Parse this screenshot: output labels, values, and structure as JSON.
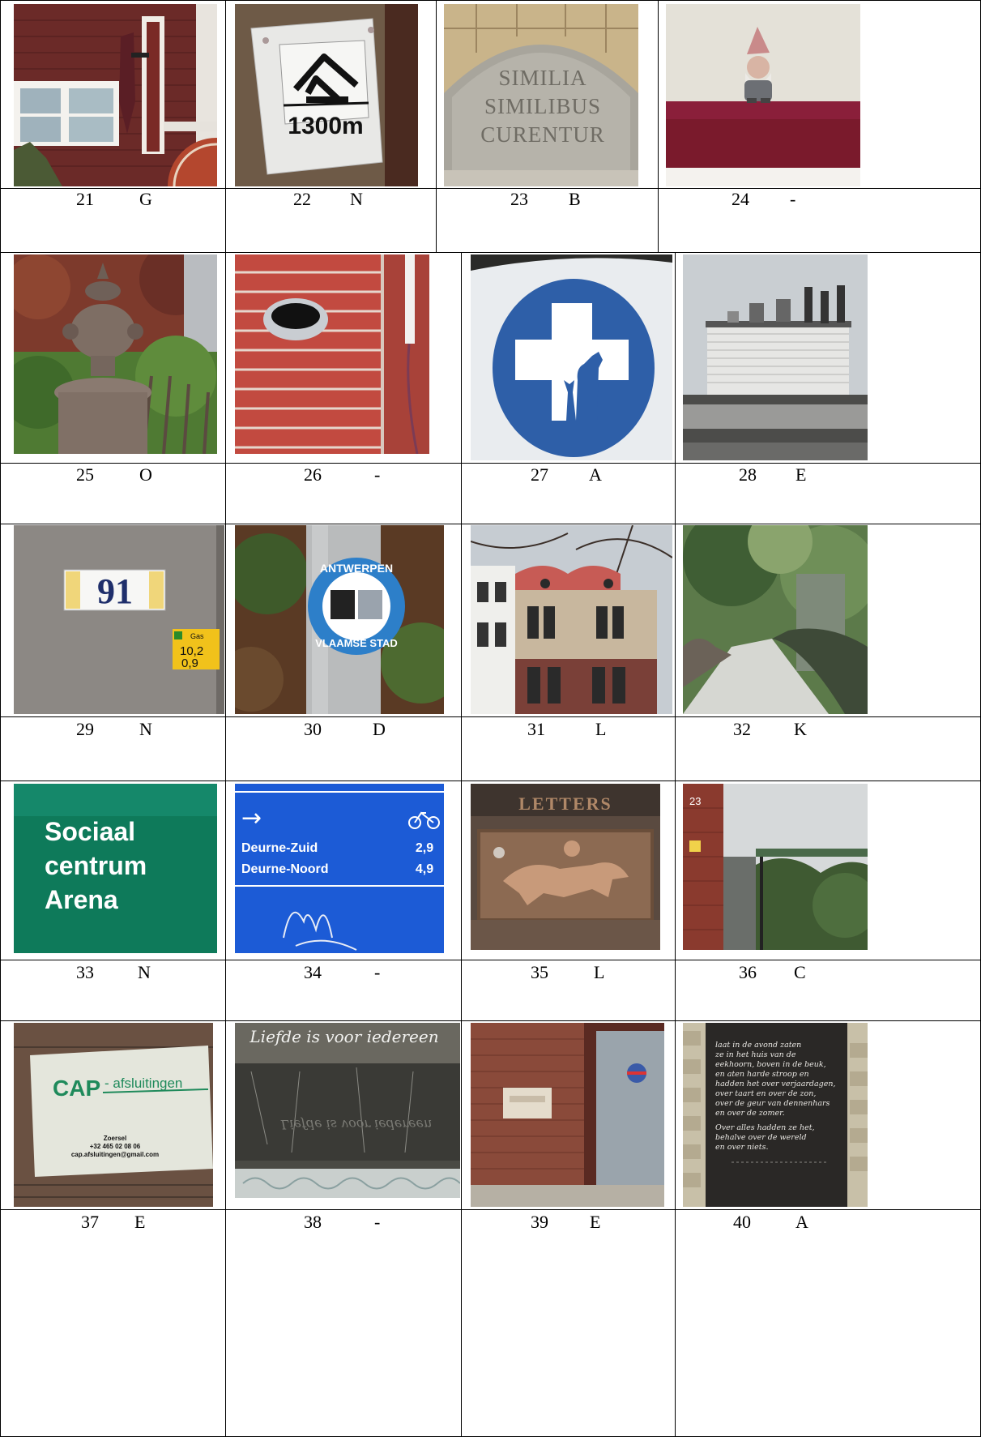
{
  "cells": [
    {
      "num": "21",
      "letter": "G"
    },
    {
      "num": "22",
      "letter": "N"
    },
    {
      "num": "23",
      "letter": "B"
    },
    {
      "num": "24",
      "letter": "-"
    },
    {
      "num": "25",
      "letter": "O"
    },
    {
      "num": "26",
      "letter": "-"
    },
    {
      "num": "27",
      "letter": "A"
    },
    {
      "num": "28",
      "letter": "E"
    },
    {
      "num": "29",
      "letter": "N"
    },
    {
      "num": "30",
      "letter": "D"
    },
    {
      "num": "31",
      "letter": "L"
    },
    {
      "num": "32",
      "letter": "K"
    },
    {
      "num": "33",
      "letter": "N"
    },
    {
      "num": "34",
      "letter": "-"
    },
    {
      "num": "35",
      "letter": "L"
    },
    {
      "num": "36",
      "letter": "C"
    },
    {
      "num": "37",
      "letter": "E"
    },
    {
      "num": "38",
      "letter": "-"
    },
    {
      "num": "39",
      "letter": "E"
    },
    {
      "num": "40",
      "letter": "A"
    }
  ],
  "photos": {
    "p22": {
      "distance": "1300m"
    },
    "p23": {
      "line1": "SIMILIA",
      "line2": "SIMILIBUS",
      "line3": "CURENTUR"
    },
    "p29": {
      "house_number": "91",
      "marker_top": "10,2",
      "marker_bottom": "0,9",
      "marker_label": "Gas"
    },
    "p30": {
      "top": "ANTWERPEN",
      "bottom": "VLAAMSE STAD"
    },
    "p33": {
      "line1": "Sociaal",
      "line2": "centrum",
      "line3": "Arena"
    },
    "p34": {
      "arrow": "→",
      "dest1": "Deurne-Zuid",
      "dist1": "2,9",
      "dest2": "Deurne-Noord",
      "dist2": "4,9"
    },
    "p35": {
      "label": "LETTERS"
    },
    "p36": {
      "house_number": "23"
    },
    "p37": {
      "brand": "CAP",
      "suffix": "- afsluitingen",
      "town": "Zoersel",
      "phone": "+32 465 02 08 06",
      "email": "cap.afsluitingen@gmail.com"
    },
    "p38": {
      "text": "Liefde is voor iedereen"
    },
    "p40": {
      "poem": [
        "laat in de avond zaten",
        "ze in het huis van de",
        "eekhoorn, boven in de beuk,",
        "en aten harde stroop en",
        "hadden het over verjaardagen,",
        "over taart en over de zon,",
        "over de geur van dennenhars",
        "en over de zomer.",
        "Over alles hadden ze het,",
        "behalve over de wereld",
        "en over niets."
      ]
    }
  },
  "colors": {
    "brick": "#8a2f2a",
    "sign_blue": "#2e5fa8",
    "sociaal_green": "#0e7a5a",
    "route_blue": "#1c5bd6",
    "cap_green": "#1f8a5b"
  }
}
